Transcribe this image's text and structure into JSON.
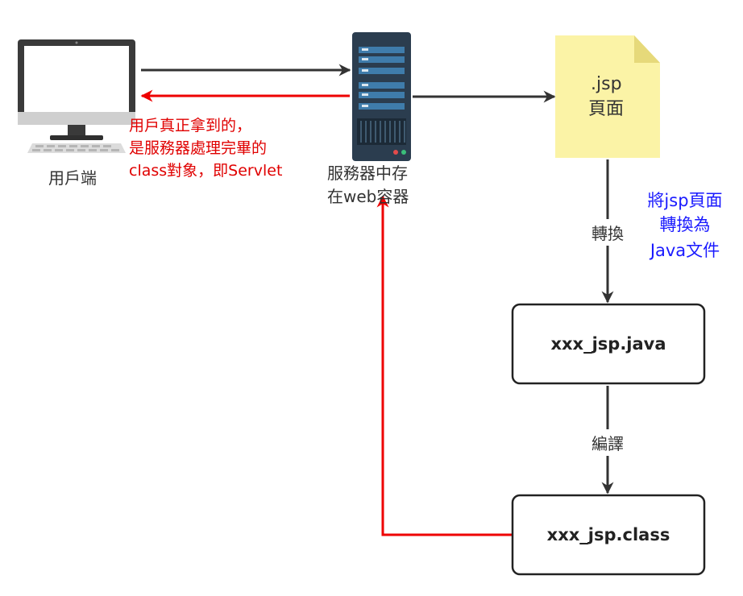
{
  "labels": {
    "client": "用戶端",
    "server_line1": "服務器中存",
    "server_line2": "在web容器",
    "jsp_file_line1": ".jsp",
    "jsp_file_line2": "頁面",
    "response_line1": "用戶真正拿到的，",
    "response_line2": "是服務器處理完畢的",
    "response_line3": "class對象，即Servlet",
    "convert_edge": "轉換",
    "convert_note_line1": "將jsp頁面",
    "convert_note_line2": "轉換為",
    "convert_note_line3": "Java文件",
    "compile_edge": "編譯"
  },
  "boxes": {
    "java_file": "xxx_jsp.java",
    "class_file": "xxx_jsp.class"
  },
  "colors": {
    "arrow": "#333333",
    "response_arrow": "#ee0000",
    "note_text": "#1a1aff",
    "file_fill": "#fbf3a6",
    "file_fold": "#e6d97a",
    "server_body": "#2b3d4f",
    "server_panel": "#3f7cab"
  },
  "icons": {
    "client": "desktop-monitor-keyboard-icon",
    "server": "server-tower-icon",
    "jsp_file": "document-page-icon"
  }
}
